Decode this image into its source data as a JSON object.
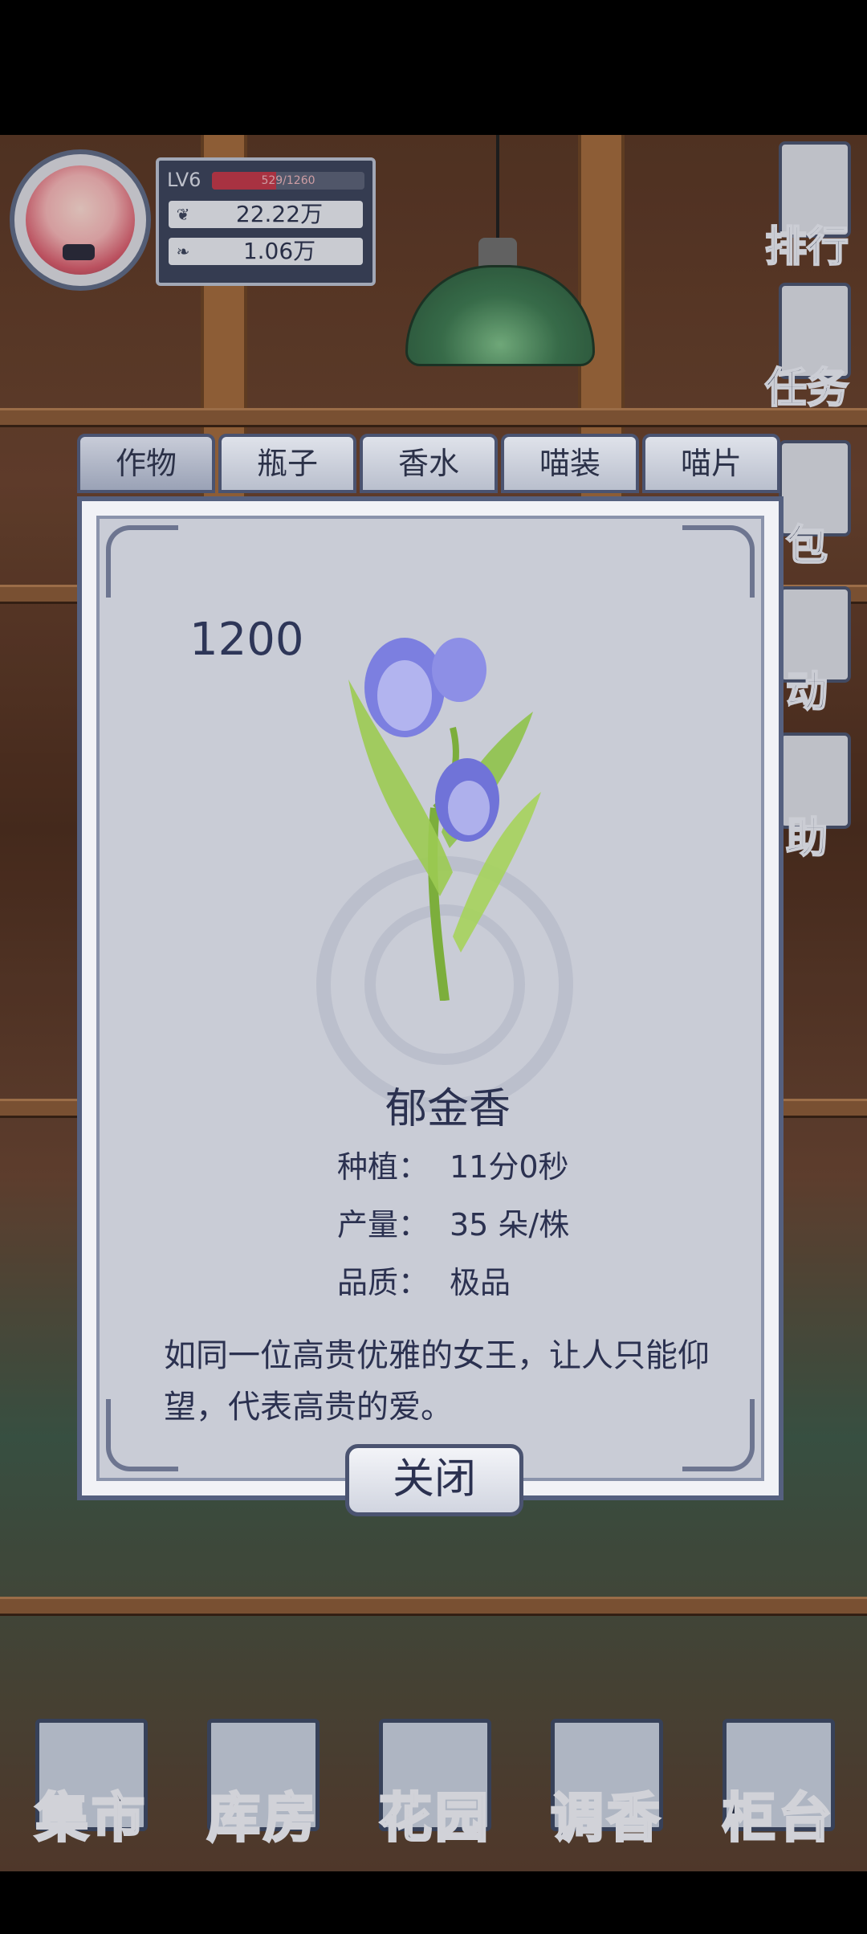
{
  "hud": {
    "level": "LV6",
    "xp_text": "529/1260",
    "xp_fraction": 0.42,
    "currency1": "22.22万",
    "currency2": "1.06万"
  },
  "side_menu": [
    {
      "label": "排行",
      "icon": "ranking-icon"
    },
    {
      "label": "任务",
      "icon": "task-clipboard-icon"
    },
    {
      "label": "包",
      "icon": "bag-icon"
    },
    {
      "label": "动",
      "icon": "event-icon"
    },
    {
      "label": "助",
      "icon": "help-icon"
    }
  ],
  "tabs": [
    "作物",
    "瓶子",
    "香水",
    "喵装",
    "喵片"
  ],
  "active_tab": 0,
  "item": {
    "price": "1200",
    "name": "郁金香",
    "details": [
      {
        "key": "种植：",
        "value": "11分0秒"
      },
      {
        "key": "产量：",
        "value": "35 朵/株"
      },
      {
        "key": "品质：",
        "value": "极品"
      }
    ],
    "description": "如同一位高贵优雅的女王，让人只能仰望，代表高贵的爱。",
    "flower_color": "#6f6fd0",
    "stem_color": "#8fc34a"
  },
  "close_label": "关闭",
  "bottom_nav": [
    {
      "label": "集市",
      "icon": "market-icon"
    },
    {
      "label": "库房",
      "icon": "warehouse-icon"
    },
    {
      "label": "花园",
      "icon": "garden-rose-icon"
    },
    {
      "label": "调香",
      "icon": "perfume-blend-icon"
    },
    {
      "label": "柜台",
      "icon": "counter-icon"
    }
  ]
}
